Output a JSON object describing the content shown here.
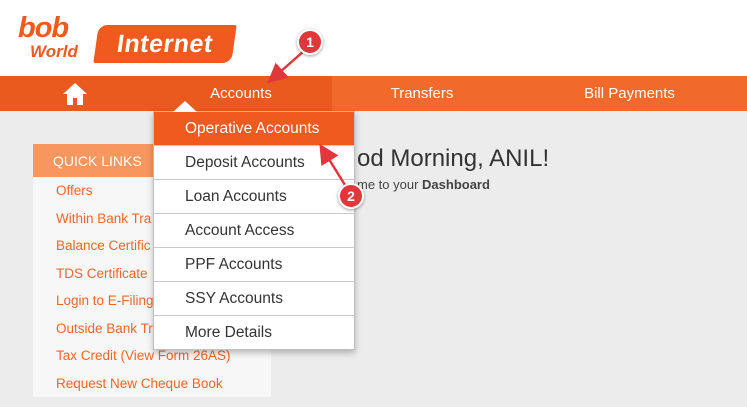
{
  "header": {
    "logo": {
      "bob": "bob",
      "world": "World",
      "internet": "Internet"
    }
  },
  "nav": {
    "home_icon": "home-icon",
    "items": [
      {
        "label": "Accounts"
      },
      {
        "label": "Transfers"
      },
      {
        "label": "Bill Payments"
      }
    ]
  },
  "accounts_menu": {
    "items": [
      {
        "label": "Operative Accounts",
        "active": true
      },
      {
        "label": "Deposit Accounts"
      },
      {
        "label": "Loan Accounts"
      },
      {
        "label": "Account Access"
      },
      {
        "label": "PPF Accounts"
      },
      {
        "label": "SSY Accounts"
      },
      {
        "label": "More Details"
      }
    ]
  },
  "quick_links": {
    "title": "QUICK LINKS",
    "items": [
      "Offers",
      "Within Bank Tra",
      "Balance Certific",
      "TDS Certificate",
      "Login to E-Filing",
      "Outside Bank Tr",
      "Tax Credit (View Form 26AS)",
      "Request New Cheque Book"
    ]
  },
  "dashboard": {
    "greeting": "od Morning, ANIL!",
    "welcome_prefix": "me to your ",
    "welcome_bold": "Dashboard"
  },
  "annotations": {
    "step1": "1",
    "step2": "2"
  },
  "colors": {
    "brand_orange": "#f05a1e",
    "nav_orange": "#f26a2b",
    "quick_links_header": "#f7965f",
    "annotation_red": "#e0373a"
  }
}
